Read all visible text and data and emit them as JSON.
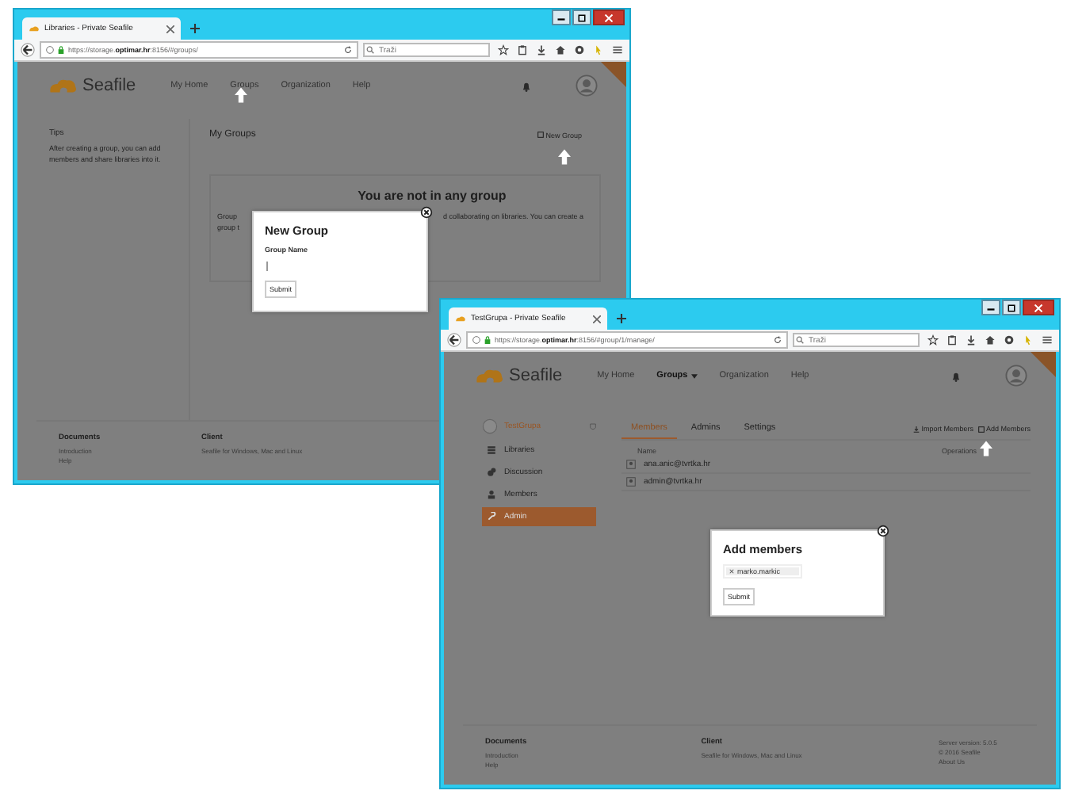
{
  "windows": [
    {
      "kind": "groups",
      "tab_title": "Libraries - Private Seafile",
      "url": "https://storage.**optimar.hr**:8156/#groups/",
      "search_placeholder": "Traži",
      "logo": "Seafile",
      "nav": [
        {
          "label": "My Home",
          "selected": false
        },
        {
          "label": "Groups",
          "selected": false
        },
        {
          "label": "Organization",
          "selected": false
        },
        {
          "label": "Help",
          "selected": false
        }
      ],
      "tips_title": "Tips",
      "tips_text": "After creating a group, you can add members and share libraries into it.",
      "heading": "My Groups",
      "action": "New Group",
      "empty_title": "You are not in any group",
      "empty_left": [
        "Group",
        "group t"
      ],
      "empty_right": "d collaborating on libraries. You can create a",
      "dialog": {
        "title": "New Group",
        "label": "Group Name",
        "submit": "Submit"
      },
      "footer": [
        {
          "title": "Documents",
          "lines": [
            "Introduction",
            "Help"
          ]
        },
        {
          "title": "Client",
          "lines": [
            "Seafile for Windows, Mac and Linux"
          ]
        }
      ]
    },
    {
      "kind": "manage",
      "tab_title": "TestGrupa - Private Seafile",
      "url": "https://storage.**optimar.hr**:8156/#group/1/manage/",
      "search_placeholder": "Traži",
      "logo": "Seafile",
      "nav": [
        {
          "label": "My Home",
          "selected": false
        },
        {
          "label": "Groups",
          "selected": true
        },
        {
          "label": "Organization",
          "selected": false
        },
        {
          "label": "Help",
          "selected": false
        }
      ],
      "group_name": "TestGrupa",
      "side": [
        {
          "label": "Libraries",
          "selected": false
        },
        {
          "label": "Discussion",
          "selected": false
        },
        {
          "label": "Members",
          "selected": false
        },
        {
          "label": "Admin",
          "selected": true
        }
      ],
      "tabs": [
        {
          "label": "Members",
          "selected": true
        },
        {
          "label": "Admins",
          "selected": false
        },
        {
          "label": "Settings",
          "selected": false
        }
      ],
      "actions": [
        "Import Members",
        "Add Members"
      ],
      "columns": [
        "Name",
        "Operations"
      ],
      "members": [
        "ana.anic@tvrtka.hr",
        "admin@tvrtka.hr"
      ],
      "dialog": {
        "title": "Add members",
        "token": "marko.markic",
        "submit": "Submit"
      },
      "footer": [
        {
          "title": "Documents",
          "lines": [
            "Introduction",
            "Help"
          ]
        },
        {
          "title": "Client",
          "lines": [
            "Seafile for Windows, Mac and Linux"
          ]
        },
        {
          "lines": [
            "Server version: 5.0.5",
            "© 2016 Seafile",
            "About Us"
          ]
        }
      ]
    }
  ]
}
